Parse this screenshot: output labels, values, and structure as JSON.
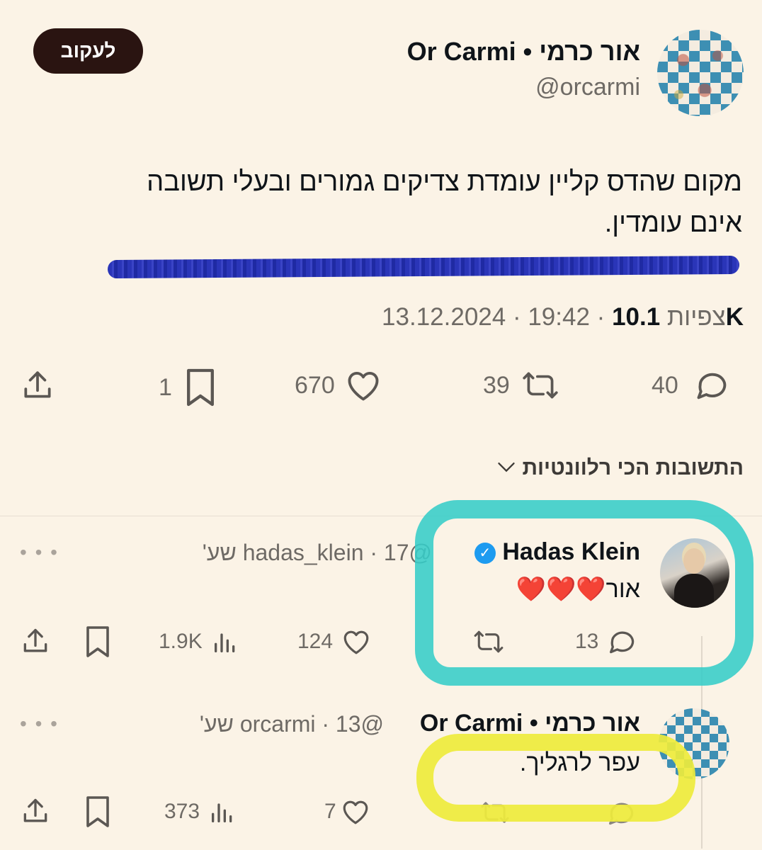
{
  "tweet": {
    "author_name": "אור כרמי • Or Carmi",
    "handle": "@orcarmi",
    "follow_label": "לעקוב",
    "text_line1": "מקום שהדס קליין עומדת צדיקים גמורים ובעלי תשובה",
    "text_line2": "אינם עומדין.",
    "date": "13.12.2024",
    "time": "19:42",
    "views_label": "צפיות",
    "views": "10.1K",
    "actions": {
      "replies": "40",
      "retweets": "39",
      "likes": "670",
      "bookmarks": "1"
    }
  },
  "replies_header": "התשובות הכי רלוונטיות",
  "replies": [
    {
      "name": "Hadas Klein",
      "handle": "@hadas_klein",
      "age": "17 שע'",
      "text": "אור",
      "hearts": "❤️❤️❤️",
      "replies": "13",
      "likes": "124",
      "views": "1.9K"
    },
    {
      "name": "אור כרמי • Or Carmi",
      "handle": "@orcarmi",
      "age": "13 שע'",
      "text": "עפר לרגליך.",
      "likes": "7",
      "views": "373"
    }
  ],
  "colors": {
    "background": "#fbf3e6",
    "follow_button": "#2a1411",
    "verified": "#1d9bf0",
    "highlight_teal": "#36cdc8",
    "highlight_yellow": "#eeec3c",
    "strike_blue": "#2a35b8"
  },
  "icons": [
    "share-icon",
    "bookmark-icon",
    "heart-icon",
    "retweet-icon",
    "reply-icon",
    "views-icon",
    "chevron-down-icon",
    "verified-icon",
    "more-icon"
  ]
}
